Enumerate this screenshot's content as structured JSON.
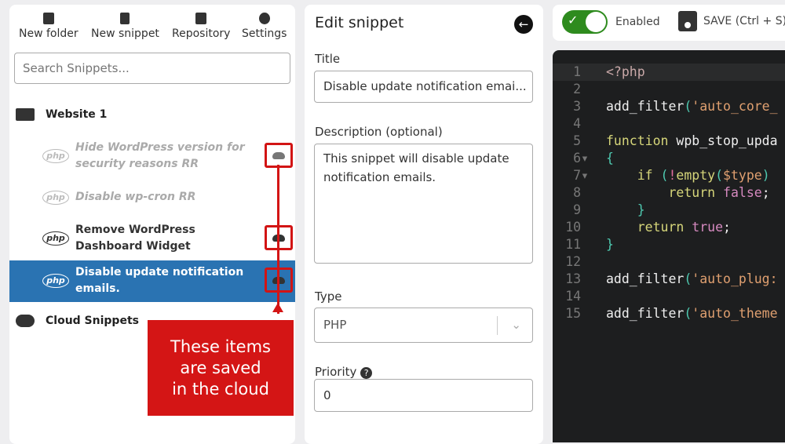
{
  "toolbar": {
    "new_folder": "New folder",
    "new_snippet": "New snippet",
    "repository": "Repository",
    "settings": "Settings"
  },
  "search": {
    "placeholder": "Search Snippets..."
  },
  "folders": [
    {
      "name": "Website 1"
    },
    {
      "name": "Cloud Snippets"
    }
  ],
  "snippets": [
    {
      "title": "Hide WordPress version for security reasons RR",
      "badge": "php",
      "enabled": false,
      "cloud": true,
      "selected": false
    },
    {
      "title": "Disable wp-cron RR",
      "badge": "php",
      "enabled": false,
      "cloud": false,
      "selected": false
    },
    {
      "title": "Remove WordPress Dashboard Widget",
      "badge": "php",
      "enabled": true,
      "cloud": true,
      "selected": false
    },
    {
      "title": "Disable update notification emails.",
      "badge": "php",
      "enabled": true,
      "cloud": true,
      "selected": true
    }
  ],
  "callout": {
    "text": "These items\nare saved\nin the cloud",
    "color": "#d41515"
  },
  "edit": {
    "heading": "Edit snippet",
    "title_label": "Title",
    "title_value": "Disable update notification emai...",
    "desc_label": "Description (optional)",
    "desc_value": "This snippet will disable update notification emails.",
    "type_label": "Type",
    "type_value": "PHP",
    "priority_label": "Priority",
    "priority_value": "0"
  },
  "topbar": {
    "enabled_label": "Enabled",
    "enabled": true,
    "save_label": "SAVE (Ctrl + S)",
    "accent": "#2e8b1e"
  },
  "code": [
    [
      {
        "t": "<?php",
        "c": "#c8a8a8"
      }
    ],
    [],
    [
      {
        "t": "add_filter",
        "c": "#f0f0f0"
      },
      {
        "t": "(",
        "c": "#4ec9b0"
      },
      {
        "t": "'auto_core_",
        "c": "#e0a070"
      }
    ],
    [],
    [
      {
        "t": "function ",
        "c": "#d6d67a"
      },
      {
        "t": "wpb_stop_upda",
        "c": "#f0f0f0"
      }
    ],
    [
      {
        "t": "{",
        "c": "#4ec9b0"
      }
    ],
    [
      {
        "t": "    if ",
        "c": "#d6d67a"
      },
      {
        "t": "(",
        "c": "#4ec9b0"
      },
      {
        "t": "!",
        "c": "#e06c9c"
      },
      {
        "t": "empty",
        "c": "#d6d67a"
      },
      {
        "t": "(",
        "c": "#4ec9b0"
      },
      {
        "t": "$type",
        "c": "#e0a070"
      },
      {
        "t": ")",
        "c": "#4ec9b0"
      }
    ],
    [
      {
        "t": "        return ",
        "c": "#d6d67a"
      },
      {
        "t": "false",
        "c": "#d68ac0"
      },
      {
        "t": ";",
        "c": "#f0f0f0"
      }
    ],
    [
      {
        "t": "    }",
        "c": "#4ec9b0"
      }
    ],
    [
      {
        "t": "    return ",
        "c": "#d6d67a"
      },
      {
        "t": "true",
        "c": "#d68ac0"
      },
      {
        "t": ";",
        "c": "#f0f0f0"
      }
    ],
    [
      {
        "t": "}",
        "c": "#4ec9b0"
      }
    ],
    [],
    [
      {
        "t": "add_filter",
        "c": "#f0f0f0"
      },
      {
        "t": "(",
        "c": "#4ec9b0"
      },
      {
        "t": "'auto_plug:",
        "c": "#e0a070"
      }
    ],
    [],
    [
      {
        "t": "add_filter",
        "c": "#f0f0f0"
      },
      {
        "t": "(",
        "c": "#4ec9b0"
      },
      {
        "t": "'auto_theme",
        "c": "#e0a070"
      }
    ]
  ]
}
